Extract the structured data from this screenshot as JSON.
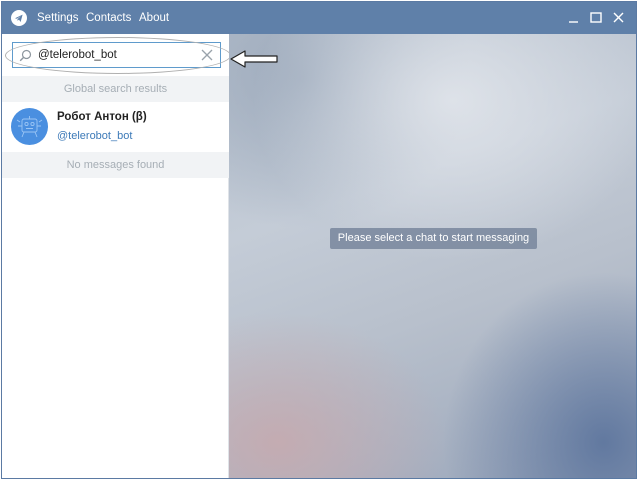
{
  "titlebar": {
    "menu": [
      "Settings",
      "Contacts",
      "About"
    ],
    "controls": [
      "minimize-icon",
      "maximize-icon",
      "close-icon"
    ]
  },
  "search": {
    "value": "@telerobot_bot",
    "icon": "search-icon"
  },
  "global_results": {
    "header": "Global search results",
    "items": [
      {
        "name": "Робот Антон (β)",
        "username": "@telerobot_bot"
      }
    ]
  },
  "messages_section": {
    "header": "No messages found"
  },
  "chat_area": {
    "placeholder": "Please select a chat to start messaging"
  },
  "colors": {
    "titlebar": "#5f80a9",
    "accent": "#4a8fe0",
    "link": "#3d7ab8"
  }
}
